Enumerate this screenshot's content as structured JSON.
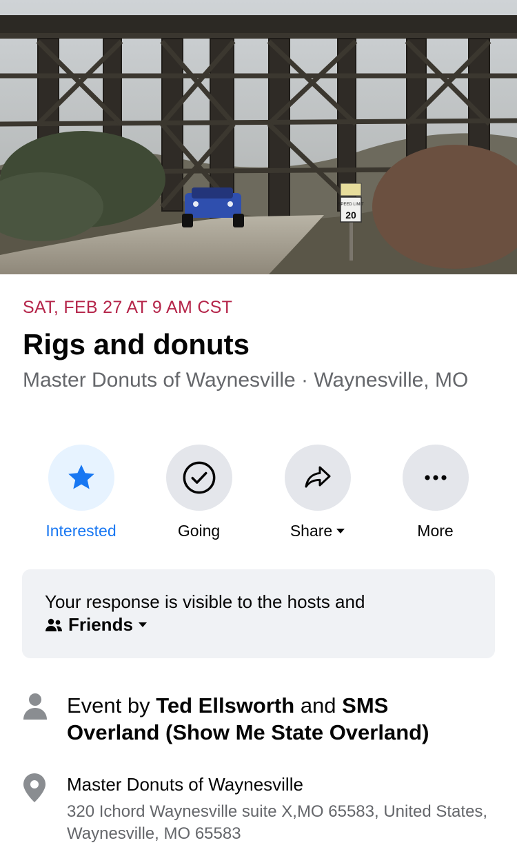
{
  "event": {
    "date": "SAT, FEB 27 AT 9 AM CST",
    "title": "Rigs and donuts",
    "location": "Master Donuts of Waynesville · Waynesville, MO"
  },
  "colors": {
    "date": "#b5254a",
    "accent": "#1877f2",
    "secondary_text": "#65676b",
    "circle_bg": "#e4e6eb",
    "active_circle_bg": "#e7f3ff",
    "notice_bg": "#f0f2f5"
  },
  "actions": [
    {
      "label": "Interested",
      "icon": "star-icon",
      "active": true
    },
    {
      "label": "Going",
      "icon": "check-circle-icon",
      "active": false
    },
    {
      "label": "Share",
      "icon": "share-icon",
      "active": false
    },
    {
      "label": "More",
      "icon": "more-icon",
      "active": false
    }
  ],
  "notice": {
    "text": "Your response is visible to the hosts and",
    "audience": "Friends",
    "audience_icon": "friends-icon"
  },
  "host": {
    "prefix": "Event by ",
    "host1": "Ted Ellsworth",
    "joiner": " and ",
    "host2": "SMS Overland (Show Me State Overland)",
    "icon": "person-icon"
  },
  "place": {
    "name": "Master Donuts of Waynesville",
    "address": "320 Ichord Waynesville suite X,MO 65583, United States, Waynesville, MO 65583",
    "icon": "map-pin-icon"
  },
  "cover": {
    "sign_top": "SPEED LIMIT",
    "sign_number": "20"
  }
}
